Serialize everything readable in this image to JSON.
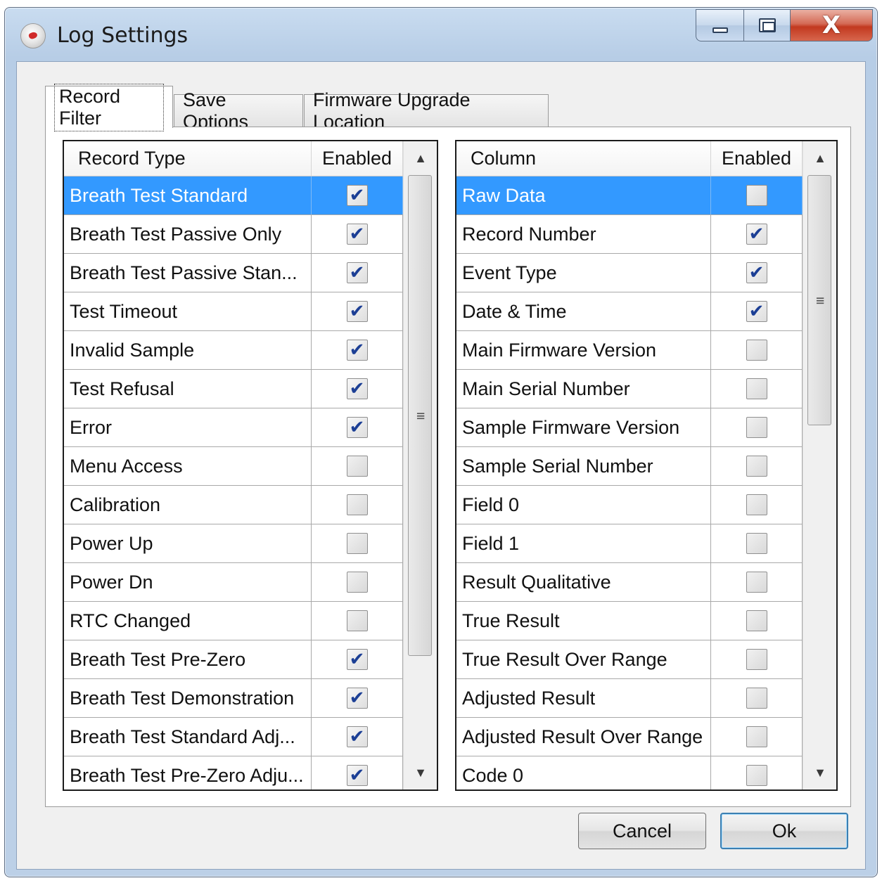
{
  "window": {
    "title": "Log Settings",
    "controls": {
      "minimize": "minimize",
      "maximize": "maximize",
      "close": "X"
    }
  },
  "tabs": [
    {
      "label": "Record Filter",
      "active": true
    },
    {
      "label": "Save Options",
      "active": false
    },
    {
      "label": "Firmware Upgrade Location",
      "active": false
    }
  ],
  "record_grid": {
    "headers": {
      "name": "Record Type",
      "enabled": "Enabled"
    },
    "rows": [
      {
        "label": "Breath Test Standard",
        "checked": true,
        "selected": true
      },
      {
        "label": "Breath Test Passive Only",
        "checked": true
      },
      {
        "label": "Breath Test Passive Stan...",
        "checked": true
      },
      {
        "label": "Test Timeout",
        "checked": true
      },
      {
        "label": "Invalid Sample",
        "checked": true
      },
      {
        "label": "Test Refusal",
        "checked": true
      },
      {
        "label": "Error",
        "checked": true
      },
      {
        "label": "Menu Access",
        "checked": false
      },
      {
        "label": "Calibration",
        "checked": false
      },
      {
        "label": "Power Up",
        "checked": false
      },
      {
        "label": "Power Dn",
        "checked": false
      },
      {
        "label": "RTC Changed",
        "checked": false
      },
      {
        "label": "Breath Test Pre-Zero",
        "checked": true
      },
      {
        "label": "Breath Test Demonstration",
        "checked": true
      },
      {
        "label": "Breath Test Standard Adj...",
        "checked": true
      },
      {
        "label": "Breath Test Pre-Zero Adju...",
        "checked": true
      }
    ]
  },
  "column_grid": {
    "headers": {
      "name": "Column",
      "enabled": "Enabled"
    },
    "rows": [
      {
        "label": "Raw Data",
        "checked": false,
        "selected": true
      },
      {
        "label": "Record Number",
        "checked": true
      },
      {
        "label": "Event Type",
        "checked": true
      },
      {
        "label": "Date & Time",
        "checked": true
      },
      {
        "label": "Main Firmware Version",
        "checked": false
      },
      {
        "label": "Main Serial Number",
        "checked": false
      },
      {
        "label": "Sample Firmware Version",
        "checked": false
      },
      {
        "label": "Sample Serial Number",
        "checked": false
      },
      {
        "label": "Field 0",
        "checked": false
      },
      {
        "label": "Field 1",
        "checked": false
      },
      {
        "label": "Result Qualitative",
        "checked": false
      },
      {
        "label": "True Result",
        "checked": false
      },
      {
        "label": "True Result Over Range",
        "checked": false
      },
      {
        "label": "Adjusted Result",
        "checked": false
      },
      {
        "label": "Adjusted Result Over Range",
        "checked": false
      },
      {
        "label": "Code 0",
        "checked": false
      }
    ]
  },
  "buttons": {
    "cancel": "Cancel",
    "ok": "Ok"
  },
  "colors": {
    "selection": "#3399ff",
    "check": "#1c3f95",
    "title_bar": "#bcd0e7"
  },
  "icons": {
    "app": "app-logo-icon",
    "check": "check-mark-icon",
    "scroll_up": "arrow-up-icon",
    "scroll_down": "arrow-down-icon",
    "grip": "scroll-grip-icon"
  }
}
